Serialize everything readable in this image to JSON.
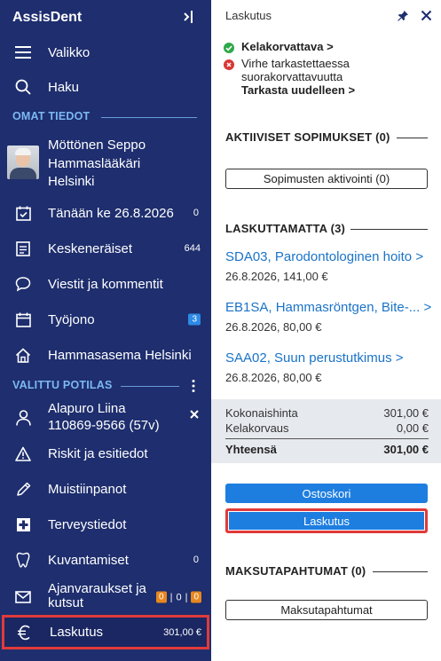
{
  "sidebar": {
    "brand": "AssisDent",
    "menu": {
      "label": "Valikko"
    },
    "search": {
      "label": "Haku"
    },
    "own_section": "OMAT TIEDOT",
    "user": {
      "name": "Möttönen Seppo",
      "role": "Hammaslääkäri",
      "city": "Helsinki"
    },
    "items": [
      {
        "label": "Tänään ke 26.8.2026",
        "count": "0"
      },
      {
        "label": "Keskeneräiset",
        "count": "644"
      },
      {
        "label": "Viestit ja kommentit",
        "count": ""
      },
      {
        "label": "Työjono",
        "count": "3"
      },
      {
        "label": "Hammasasema Helsinki",
        "count": ""
      }
    ],
    "patient_section": "VALITTU POTILAS",
    "patient": {
      "name": "Alapuro Liina",
      "id": "110869-9566 (57v)"
    },
    "patient_items": [
      {
        "label": "Riskit ja esitiedot"
      },
      {
        "label": "Muistiinpanot"
      },
      {
        "label": "Terveystiedot"
      },
      {
        "label": "Kuvantamiset",
        "count": "0"
      },
      {
        "label_line1": "Ajanvaraukset ja",
        "label_line2": "kutsut",
        "badge_a": "0",
        "sep1": "|",
        "mid": "0",
        "sep2": "|",
        "badge_b": "0"
      },
      {
        "label": "Laskutus",
        "amount": "301,00 €"
      }
    ]
  },
  "panel": {
    "title": "Laskutus",
    "status": {
      "ok_label": "Kelakorvattava",
      "ok_chevron": ">",
      "err_line1": "Virhe tarkastettaessa",
      "err_line2": "suorakorvattavuutta",
      "recheck": "Tarkasta uudelleen",
      "recheck_chevron": ">"
    },
    "contracts": {
      "title": "AKTIIVISET SOPIMUKSET (0)",
      "button": "Sopimusten aktivointi (0)"
    },
    "unbilled": {
      "title": "LASKUTTAMATTA (3)",
      "items": [
        {
          "link": "SDA03, Parodontologinen hoito",
          "chevron": ">",
          "detail": "26.8.2026, 141,00 €"
        },
        {
          "link": "EB1SA, Hammasröntgen, Bite-...",
          "chevron": ">",
          "detail": "26.8.2026, 80,00 €"
        },
        {
          "link": "SAA02, Suun perustutkimus",
          "chevron": ">",
          "detail": "26.8.2026, 80,00 €"
        }
      ]
    },
    "totals": {
      "total_label": "Kokonaishinta",
      "total_value": "301,00 €",
      "kela_label": "Kelakorvaus",
      "kela_value": "0,00 €",
      "sum_label": "Yhteensä",
      "sum_value": "301,00 €"
    },
    "buttons": {
      "cart": "Ostoskori",
      "billing": "Laskutus"
    },
    "payments": {
      "title": "MAKSUTAPAHTUMAT (0)",
      "button": "Maksutapahtumat"
    }
  },
  "colors": {
    "sidebar_bg": "#1e2e6e",
    "section_title": "#7db8f2",
    "link_blue": "#1a73c8",
    "button_blue": "#1e7ee0",
    "highlight_red": "#e03a3a",
    "ok_green": "#2ea84a",
    "error_red": "#d93636",
    "badge_orange": "#e8871e"
  }
}
